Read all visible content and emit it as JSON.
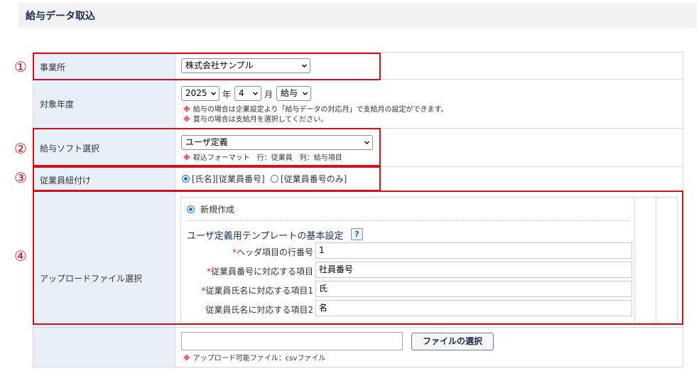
{
  "page": {
    "title": "給与データ取込"
  },
  "colors": {
    "accent": "#d4101a",
    "label_bg": "#e7f0f8",
    "title_color": "#1d2a57"
  },
  "office": {
    "label": "事業所",
    "selected": "株式会社サンプル"
  },
  "target_year": {
    "label": "対象年度",
    "year": "2025",
    "year_unit": "年",
    "month": "4",
    "month_unit": "月",
    "type": "給与",
    "note1": "給与の場合は企業設定より「給与データの対応月」で支給月の設定ができます。",
    "note2": "賞与の場合は支給月を選択してください。",
    "note_mark": "※"
  },
  "software": {
    "label": "給与ソフト選択",
    "selected": "ユーザ定義",
    "note": "取込フォーマット　行：従業員　列：給与項目",
    "note_mark": "※"
  },
  "employee_link": {
    "label": "従業員紐付け",
    "option1": "[氏名][従業員番号]",
    "option2": "[従業員番号のみ]",
    "selected_option": 1
  },
  "upload": {
    "label": "アップロードファイル選択",
    "new_label": "新規作成",
    "template_heading": "ユーザ定義用テンプレートの基本設定",
    "help": "?",
    "required_mark": "*",
    "fields": [
      {
        "label": "ヘッダ項目の行番号",
        "value": "1",
        "required": true
      },
      {
        "label": "従業員番号に対応する項目",
        "value": "社員番号",
        "required": true
      },
      {
        "label": "従業員氏名に対応する項目1",
        "value": "氏",
        "required": true
      },
      {
        "label": "従業員氏名に対応する項目2",
        "value": "名",
        "required": false
      }
    ],
    "file_button": "ファイルの選択",
    "file_note": "アップロード可能ファイル：csvファイル",
    "note_mark": "※"
  },
  "markers": [
    "①",
    "②",
    "③",
    "④"
  ]
}
